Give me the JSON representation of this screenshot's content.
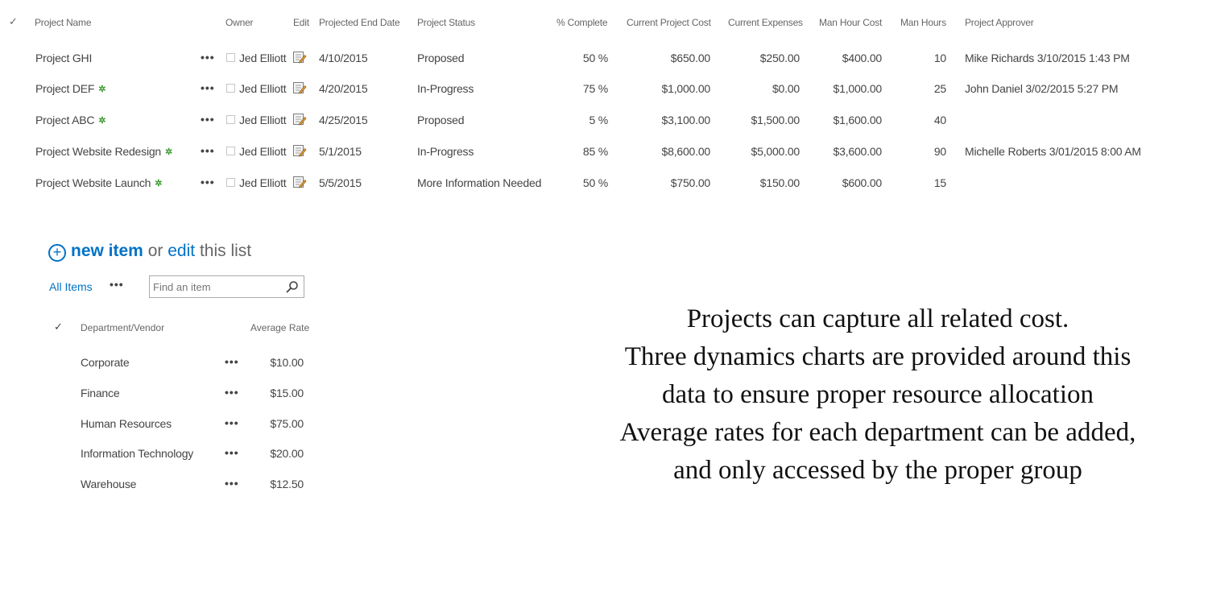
{
  "projects": {
    "select_all_glyph": "✓",
    "columns": {
      "name": "Project Name",
      "owner": "Owner",
      "edit": "Edit",
      "end_date": "Projected End Date",
      "status": "Project Status",
      "complete": "% Complete",
      "cost": "Current Project Cost",
      "expenses": "Current Expenses",
      "hour_cost": "Man Hour Cost",
      "hours": "Man Hours",
      "approver": "Project Approver"
    },
    "rows": [
      {
        "name": "Project GHI",
        "is_new": false,
        "owner": "Jed Elliott",
        "end_date": "4/10/2015",
        "status": "Proposed",
        "complete": "50 %",
        "cost": "$650.00",
        "expenses": "$250.00",
        "hour_cost": "$400.00",
        "hours": "10",
        "approver": "Mike Richards 3/10/2015 1:43 PM"
      },
      {
        "name": "Project DEF",
        "is_new": true,
        "owner": "Jed Elliott",
        "end_date": "4/20/2015",
        "status": "In-Progress",
        "complete": "75 %",
        "cost": "$1,000.00",
        "expenses": "$0.00",
        "hour_cost": "$1,000.00",
        "hours": "25",
        "approver": "John Daniel 3/02/2015 5:27 PM"
      },
      {
        "name": "Project ABC",
        "is_new": true,
        "owner": "Jed Elliott",
        "end_date": "4/25/2015",
        "status": "Proposed",
        "complete": "5 %",
        "cost": "$3,100.00",
        "expenses": "$1,500.00",
        "hour_cost": "$1,600.00",
        "hours": "40",
        "approver": ""
      },
      {
        "name": "Project Website Redesign",
        "is_new": true,
        "owner": "Jed Elliott",
        "end_date": "5/1/2015",
        "status": "In-Progress",
        "complete": "85 %",
        "cost": "$8,600.00",
        "expenses": "$5,000.00",
        "hour_cost": "$3,600.00",
        "hours": "90",
        "approver": "Michelle Roberts 3/01/2015 8:00 AM"
      },
      {
        "name": "Project Website Launch",
        "is_new": true,
        "owner": "Jed Elliott",
        "end_date": "5/5/2015",
        "status": "More Information Needed",
        "complete": "50 %",
        "cost": "$750.00",
        "expenses": "$150.00",
        "hour_cost": "$600.00",
        "hours": "15",
        "approver": ""
      }
    ],
    "new_flag_glyph": "✲",
    "ellipsis": "•••"
  },
  "rates_list": {
    "plus_glyph": "+",
    "new_item_label": "new item",
    "or_label": "or",
    "edit_label": "edit",
    "this_list_label": "this list",
    "view_label": "All Items",
    "view_menu": "•••",
    "search_placeholder": "Find an item",
    "select_all_glyph": "✓",
    "columns": {
      "department": "Department/Vendor",
      "rate": "Average Rate"
    },
    "rows": [
      {
        "department": "Corporate",
        "rate": "$10.00"
      },
      {
        "department": "Finance",
        "rate": "$15.00"
      },
      {
        "department": "Human Resources",
        "rate": "$75.00"
      },
      {
        "department": "Information Technology",
        "rate": "$20.00"
      },
      {
        "department": "Warehouse",
        "rate": "$12.50"
      }
    ],
    "ellipsis": "•••"
  },
  "caption": {
    "lines": [
      "Projects can capture all related cost.",
      "Three dynamics charts are provided around this",
      "data to ensure proper resource allocation",
      "Average rates for each department can be added,",
      "and only accessed by the proper group"
    ]
  },
  "colors": {
    "accent": "#0072c6",
    "new_flag": "#3d9a32",
    "text": "#444444",
    "caption": "#111111"
  }
}
